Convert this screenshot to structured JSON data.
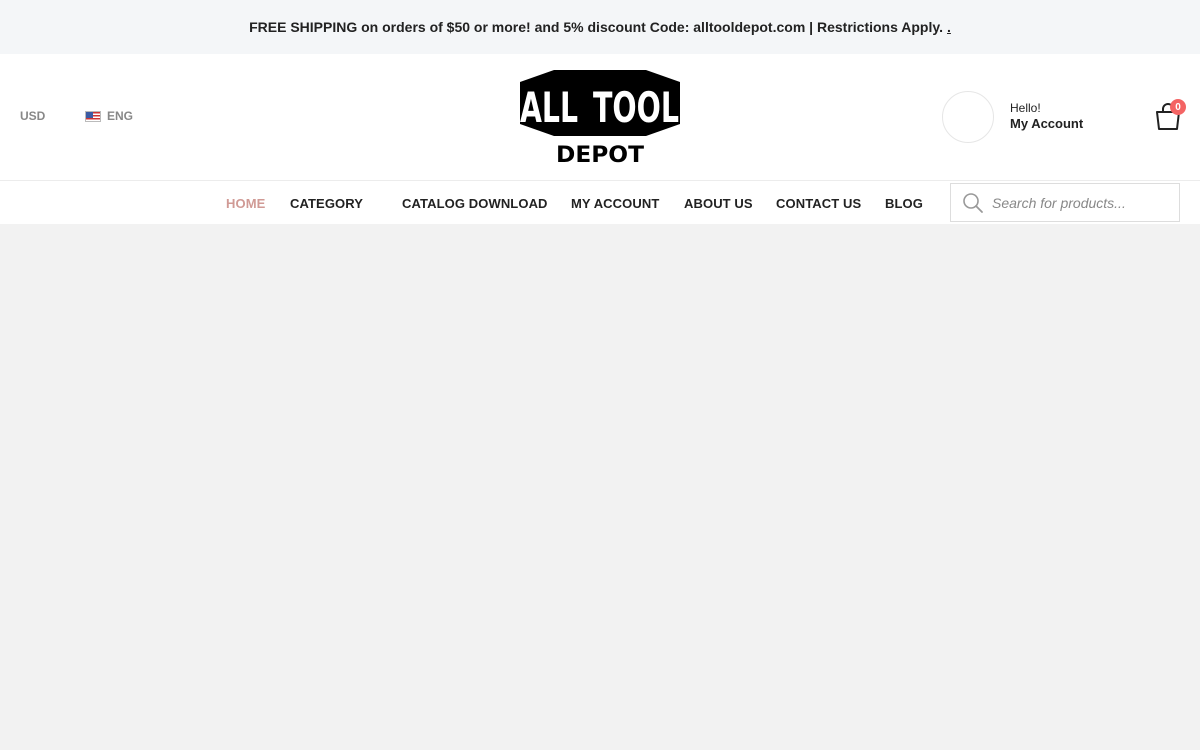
{
  "topbar": {
    "message": "FREE SHIPPING on orders of $50 or more! and 5% discount Code: alltooldepot.com | Restrictions Apply.",
    "link_text": "."
  },
  "header": {
    "currency": "USD",
    "language": "ENG",
    "logo": {
      "line1_left": "ALL",
      "line1_right": "TOOL",
      "line2": "DEPOT"
    },
    "account": {
      "greeting": "Hello!",
      "label": "My Account"
    },
    "cart": {
      "count": "0"
    }
  },
  "nav": {
    "items": [
      {
        "label": "HOME",
        "active": true
      },
      {
        "label": "CATEGORY"
      },
      {
        "label": "CATALOG DOWNLOAD"
      },
      {
        "label": "MY ACCOUNT"
      },
      {
        "label": "ABOUT US"
      },
      {
        "label": "CONTACT US"
      },
      {
        "label": "BLOG"
      }
    ]
  },
  "search": {
    "placeholder": "Search for products..."
  },
  "colors": {
    "accent_active_nav": "#d09a95",
    "cart_badge": "#f46464",
    "topbar_bg": "#f4f6f8",
    "page_bg": "#f2f2f2"
  },
  "icons": {
    "search": "search-icon",
    "cart": "shopping-bag-icon",
    "flag": "us-flag-icon"
  }
}
